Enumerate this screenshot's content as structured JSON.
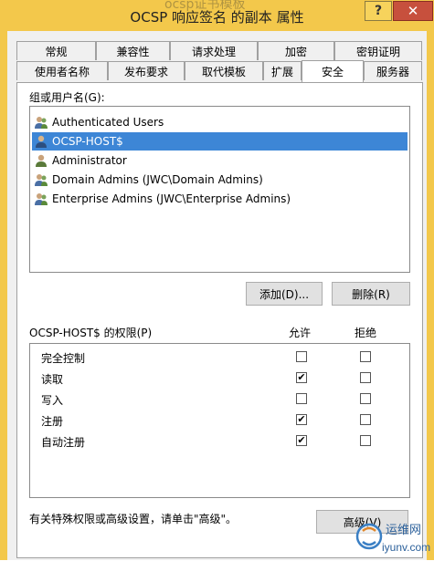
{
  "window": {
    "title": "OCSP 响应签名 的副本 属性",
    "behind_title": "ocsp证书模板",
    "help_label": "?",
    "close_label": "✕"
  },
  "tabs_row1": [
    "常规",
    "兼容性",
    "请求处理",
    "加密",
    "密钥证明"
  ],
  "tabs_row2": [
    "使用者名称",
    "发布要求",
    "取代模板",
    "扩展",
    "安全",
    "服务器"
  ],
  "security": {
    "group_label": "组或用户名(G):",
    "users": [
      {
        "name": "Authenticated Users",
        "icon": "group-icon"
      },
      {
        "name": "OCSP-HOST$",
        "icon": "user-icon",
        "selected": true
      },
      {
        "name": "Administrator",
        "icon": "user-icon"
      },
      {
        "name": "Domain Admins (JWC\\Domain Admins)",
        "icon": "group-icon"
      },
      {
        "name": "Enterprise Admins (JWC\\Enterprise Admins)",
        "icon": "group-icon"
      }
    ],
    "add_button": "添加(D)...",
    "remove_button": "删除(R)",
    "permissions_label": "OCSP-HOST$ 的权限(P)",
    "allow_header": "允许",
    "deny_header": "拒绝",
    "permissions": [
      {
        "name": "完全控制",
        "allow": false,
        "deny": false
      },
      {
        "name": "读取",
        "allow": true,
        "deny": false
      },
      {
        "name": "写入",
        "allow": false,
        "deny": false
      },
      {
        "name": "注册",
        "allow": true,
        "deny": false
      },
      {
        "name": "自动注册",
        "allow": true,
        "deny": false
      }
    ],
    "advanced_hint": "有关特殊权限或高级设置，请单击\"高级\"。",
    "advanced_button": "高级(V)"
  },
  "watermark": {
    "brand": "运维网",
    "domain": "iyunv.com"
  },
  "colors": {
    "titlebar": "#f3c84b",
    "selection": "#3d86d6",
    "close": "#c7503d"
  }
}
